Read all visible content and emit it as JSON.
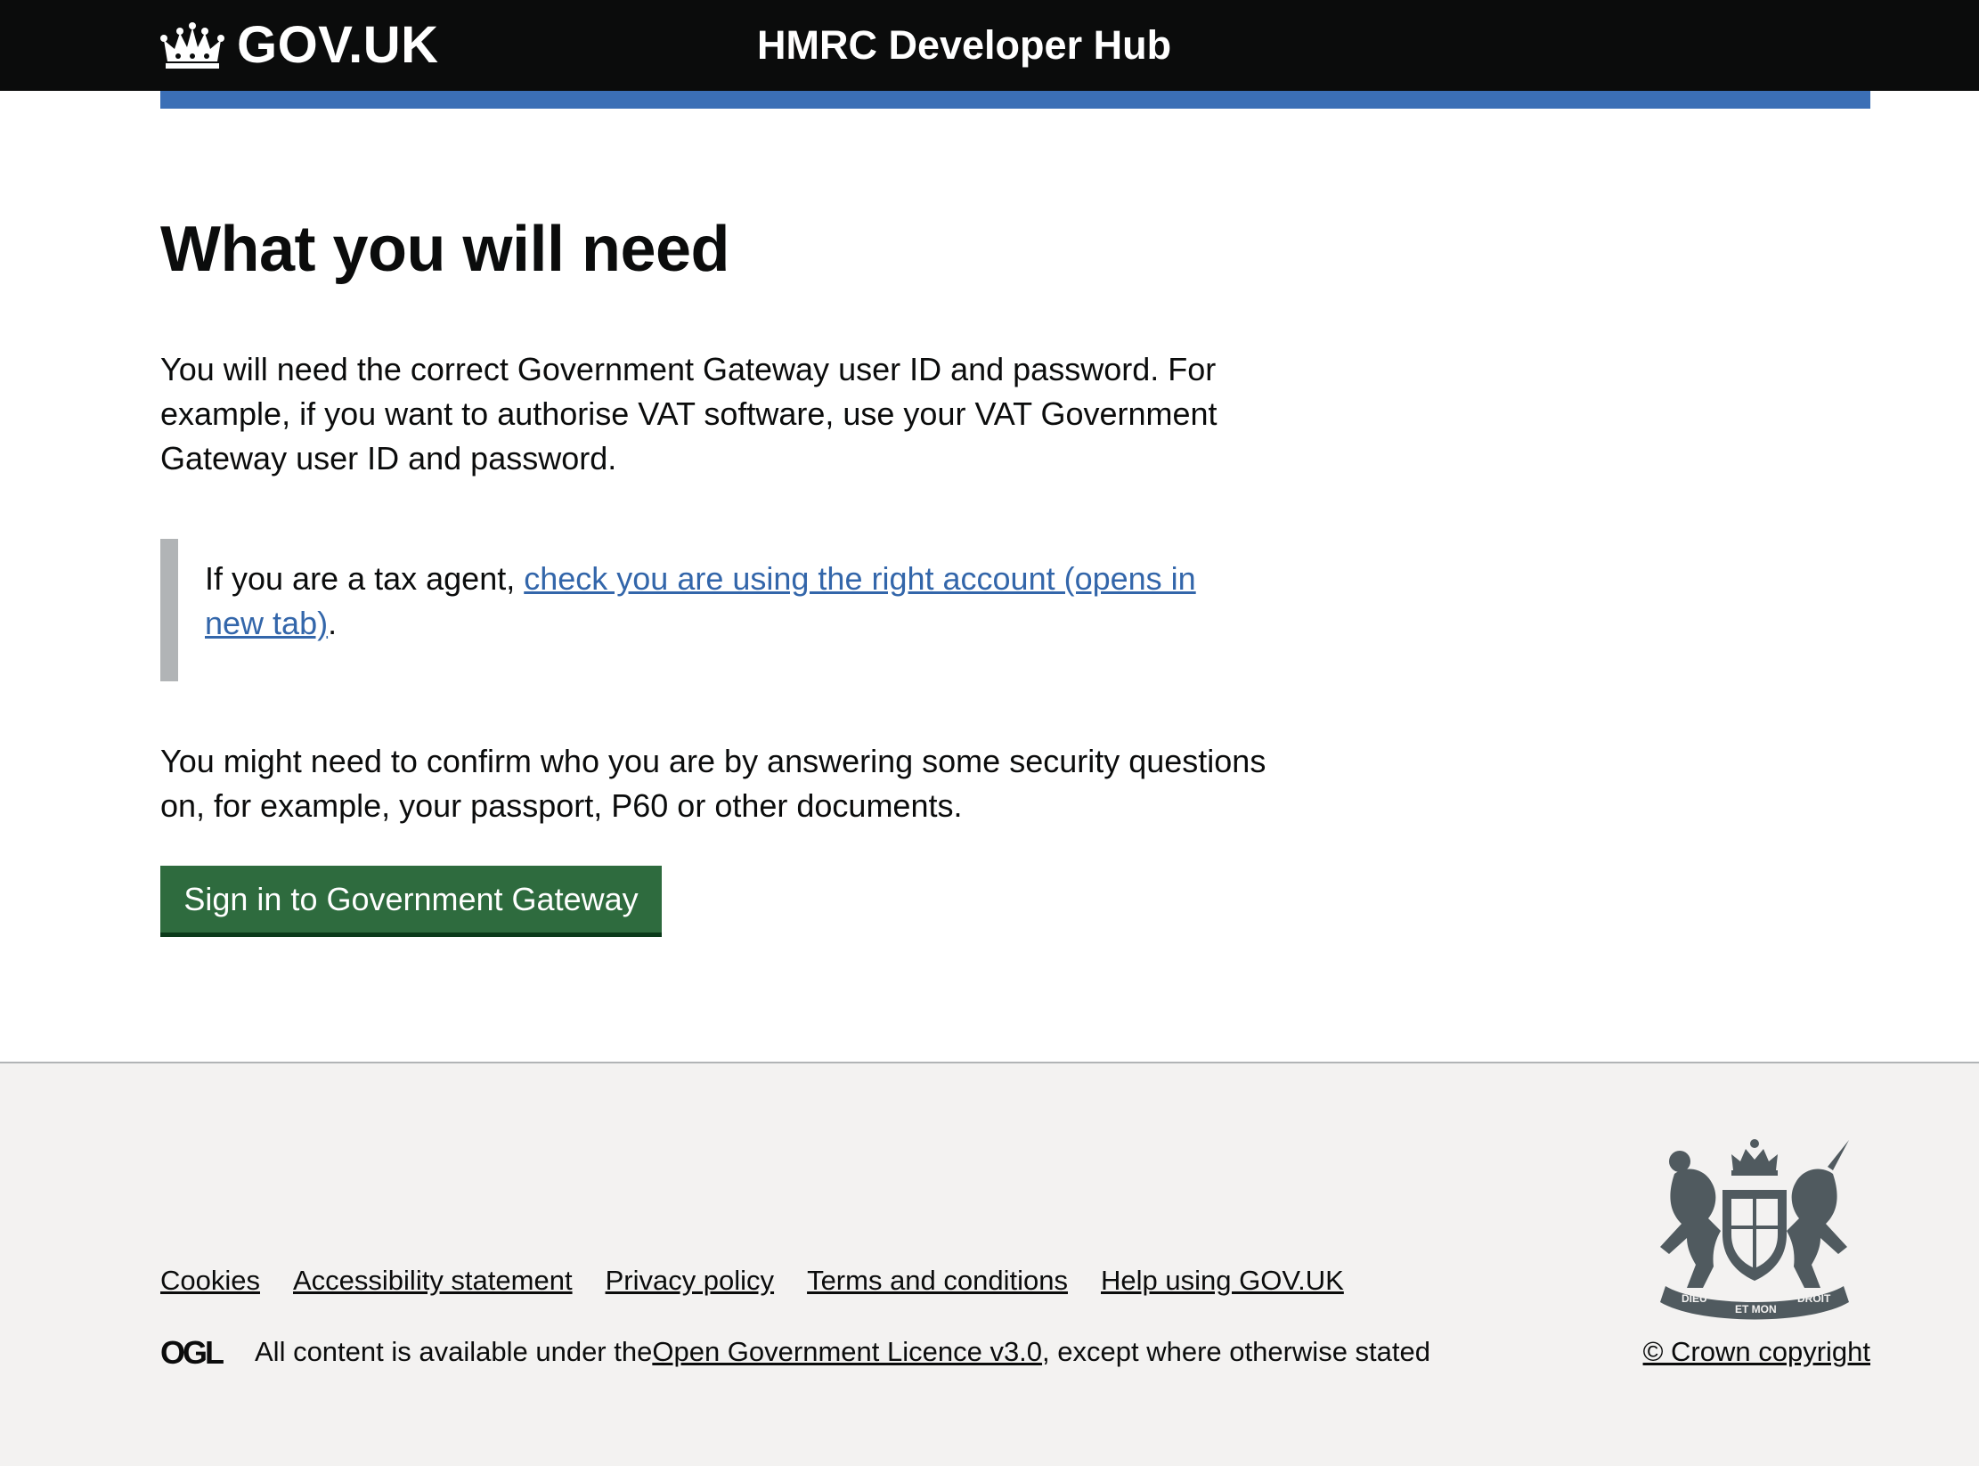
{
  "header": {
    "logo_text": "GOV.UK",
    "service_name": "HMRC Developer Hub"
  },
  "main": {
    "title": "What you will need",
    "para1": "You will need the correct Government Gateway user ID and password. For example, if you want to authorise VAT software, use your VAT Government Gateway user ID and password.",
    "inset_prefix": "If you are a tax agent, ",
    "inset_link": "check you are using the right account (opens in new tab)",
    "inset_suffix": ".",
    "para2": "You might need to confirm who you are by answering some security questions on, for example, your passport, P60 or other documents.",
    "button_label": "Sign in to Government Gateway"
  },
  "footer": {
    "links": [
      "Cookies",
      "Accessibility statement",
      "Privacy policy",
      "Terms and conditions",
      "Help using GOV.UK"
    ],
    "licence_prefix": "All content is available under the ",
    "licence_link": "Open Government Licence v3.0 ",
    "licence_suffix": ", except where otherwise stated",
    "copyright": "© Crown copyright",
    "ogl_logo_text": "OGL",
    "crest_motto_1": "DIEU",
    "crest_motto_2": "ET MON",
    "crest_motto_3": "DROIT"
  },
  "colors": {
    "header_bg": "#0b0c0c",
    "header_bar": "#3b6fb6",
    "link": "#3366aa",
    "button": "#2e6b3e",
    "footer_bg": "#f3f2f1",
    "inset_border": "#b1b4b6"
  },
  "icons": {
    "crown": "crown-icon",
    "ogl": "ogl-logo-icon",
    "crest": "royal-coat-of-arms-icon"
  }
}
